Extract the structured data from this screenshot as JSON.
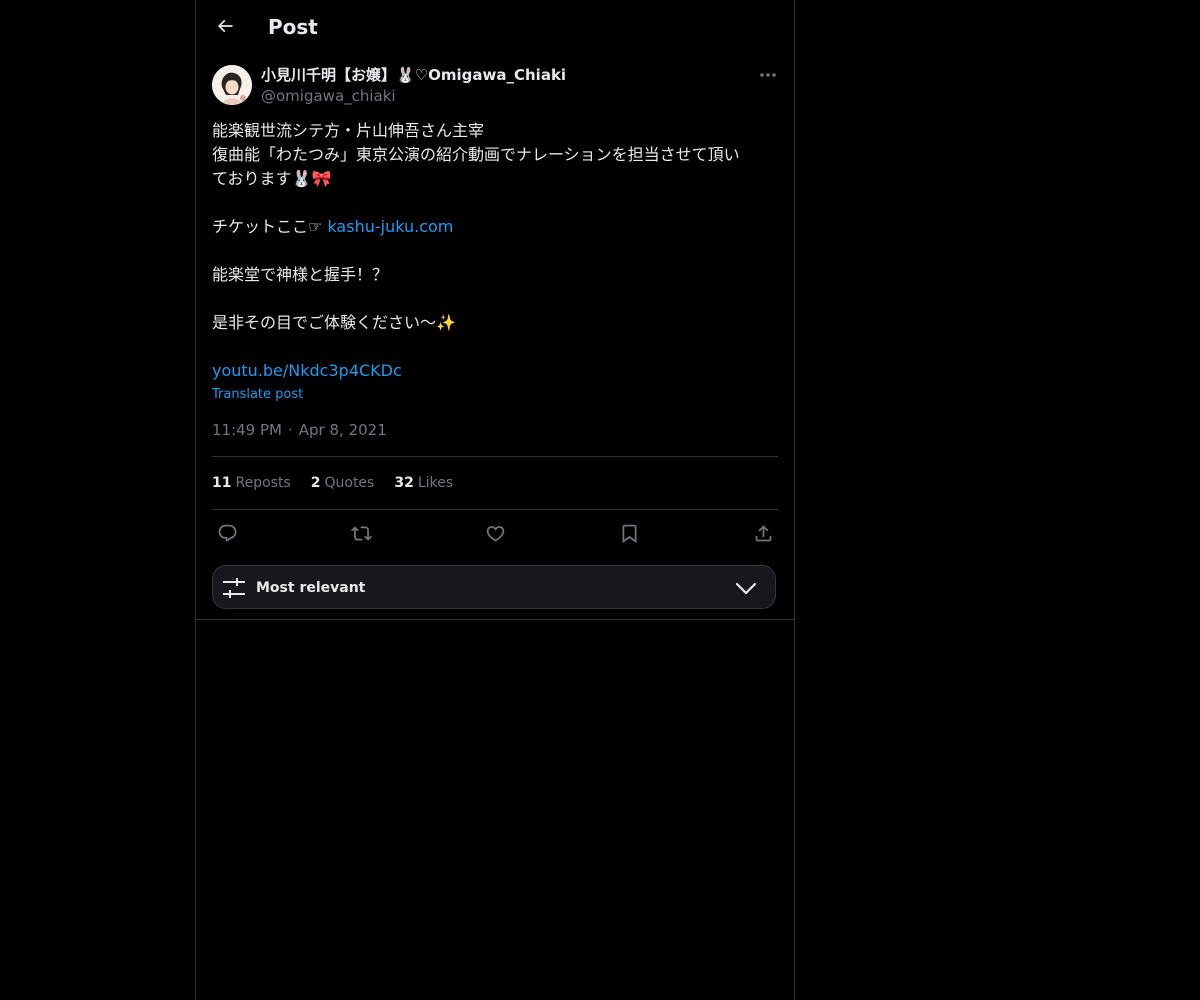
{
  "header": {
    "title": "Post",
    "back_icon": "arrow-left-icon"
  },
  "post": {
    "author": {
      "display_name": "小見川千明【お嬢】🐰♡Omigawa_Chiaki",
      "handle": "@omigawa_chiaki"
    },
    "body": {
      "line1": "能楽観世流シテ方・片山伸吾さん主宰",
      "line2": "復曲能「わたつみ」東京公演の紹介動画でナレーションを担当させて頂い",
      "line3": "ております🐰🎀",
      "ticket_prefix": "チケットここ☞ ",
      "ticket_link": "kashu-juku.com",
      "line5": "能楽堂で神様と握手！？",
      "line6": "是非その目でご体験ください〜✨",
      "video_link": "youtu.be/Nkdc3p4CKDc"
    },
    "translate_label": "Translate post",
    "time": "11:49 PM",
    "date": "Apr 8, 2021",
    "time_separator": "·",
    "stats": {
      "reposts_count": "11",
      "reposts_label": "Reposts",
      "quotes_count": "2",
      "quotes_label": "Quotes",
      "likes_count": "32",
      "likes_label": "Likes"
    },
    "actions": [
      "reply-icon",
      "repost-icon",
      "like-icon",
      "bookmark-icon",
      "share-icon"
    ]
  },
  "sort": {
    "label": "Most relevant",
    "icon": "sliders-icon",
    "chevron": "chevron-down-icon"
  },
  "colors": {
    "background": "#000000",
    "text": "#e7e9ea",
    "muted": "#71767b",
    "link": "#1d9bf0",
    "border": "#2f3336"
  }
}
